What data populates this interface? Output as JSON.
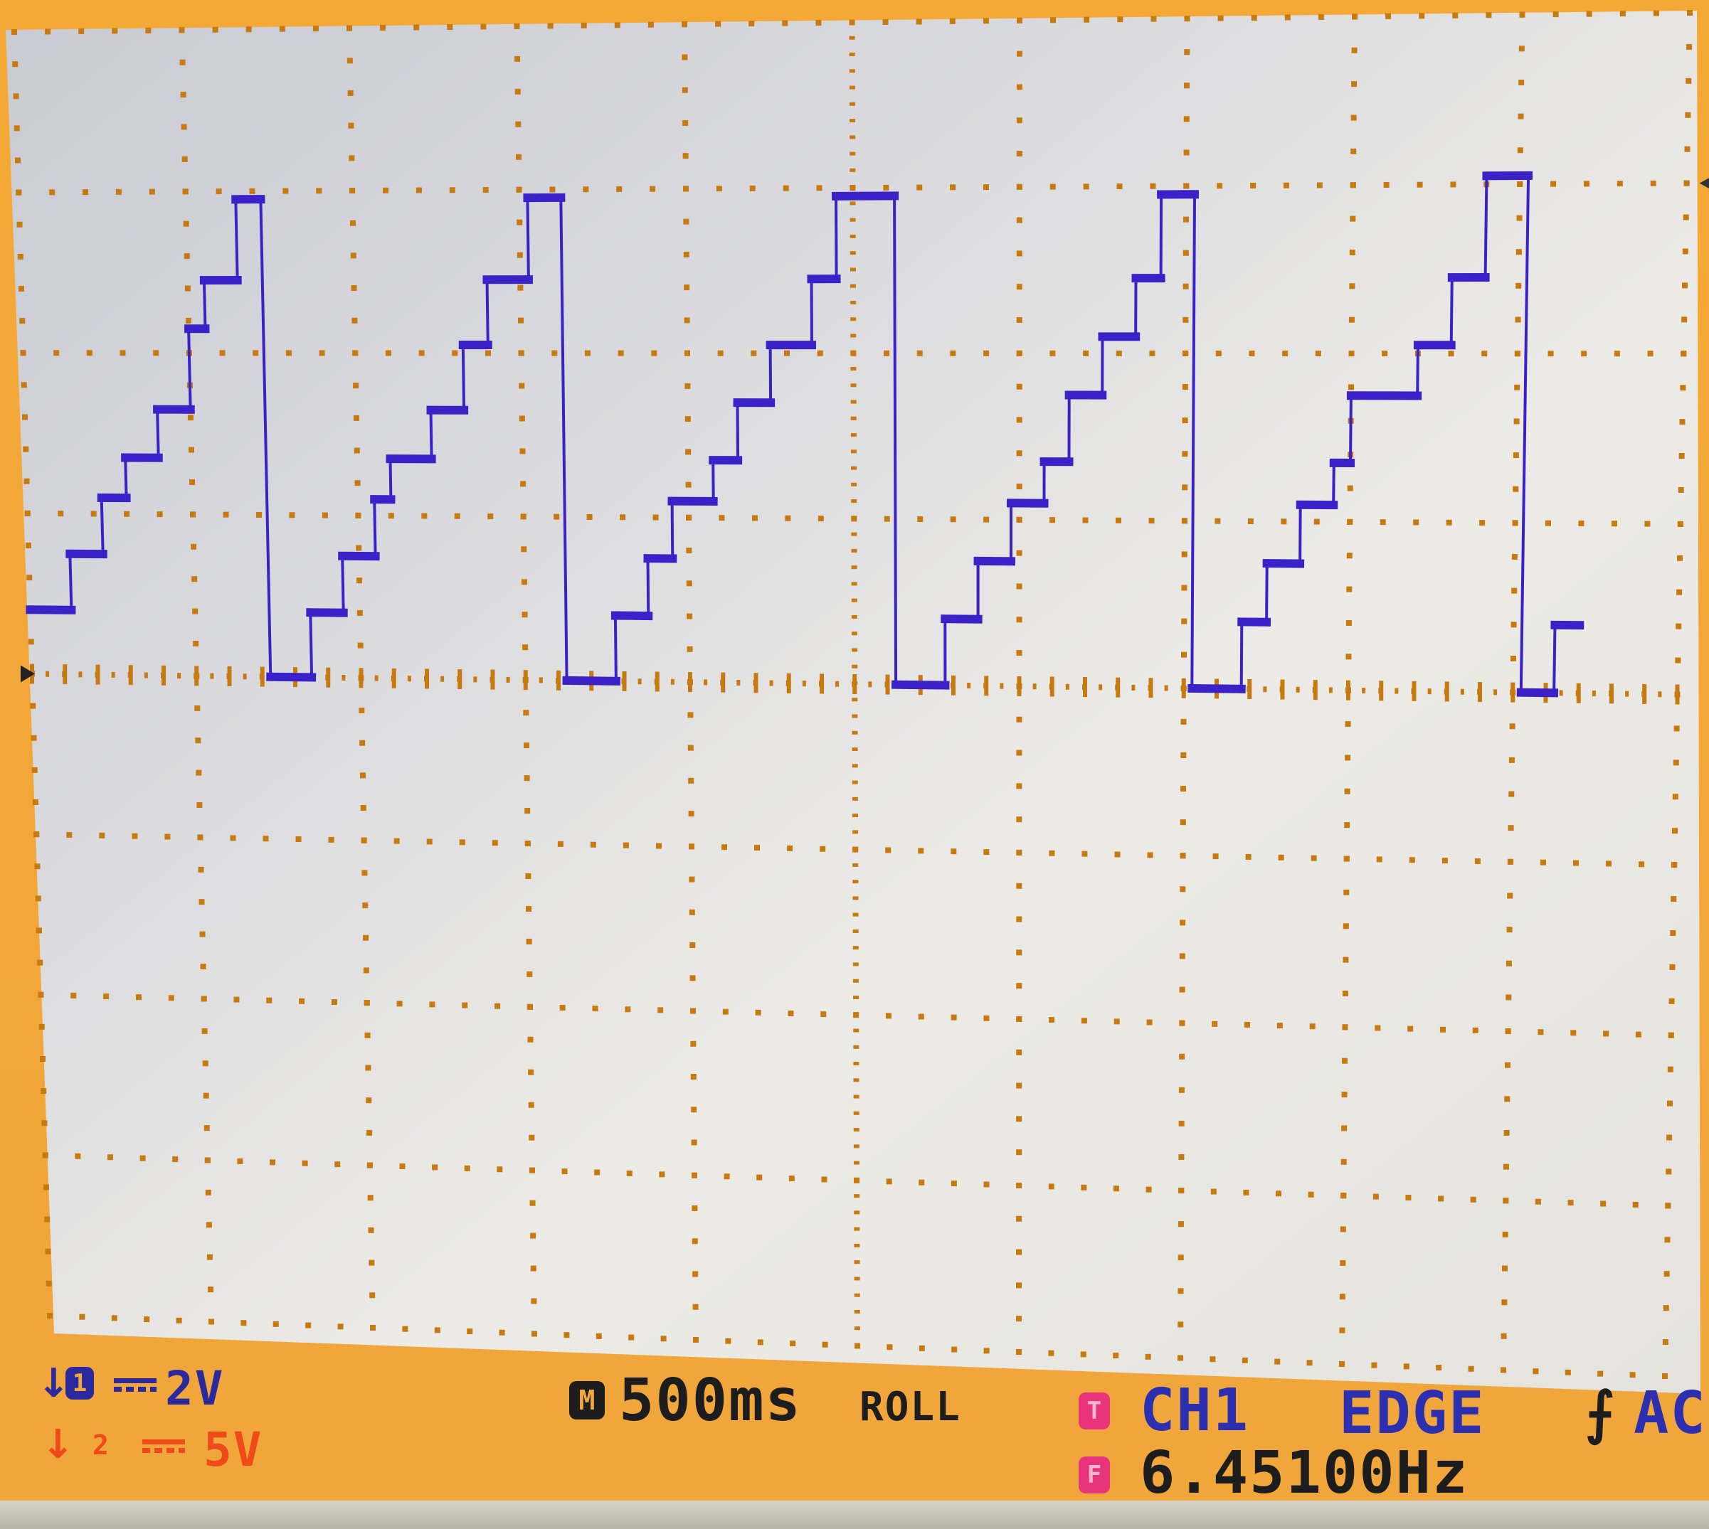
{
  "status": {
    "ch1_coupling": "2V",
    "ch2_coupling": "5V",
    "ch1_badge": "1",
    "ch2_badge": "2",
    "timebase_badge": "M",
    "timebase": "500ms",
    "mode": "ROLL",
    "trigger_badge": "T",
    "trigger_source": "CH1",
    "trigger_type": "EDGE",
    "trigger_coupling": "AC",
    "freq_badge": "F",
    "frequency": "6.45100Hz"
  },
  "colors": {
    "frame": "#f2a93a",
    "grid_dots": "#c77a10",
    "trace": "#3a22c8",
    "ch1_text": "#2a2a9e",
    "ch2_text": "#f04a1a",
    "trigger_text": "#2b2fb0",
    "badge_pink": "#e8347a",
    "dark_text": "#1d1d1d"
  },
  "chart_data": {
    "type": "line",
    "title": "",
    "xlabel": "",
    "ylabel": "",
    "grid": true,
    "legend": "none",
    "xlim": [
      0,
      10
    ],
    "ylim": [
      -4,
      4
    ],
    "series": [
      {
        "name": "CH1",
        "points": [
          [
            0.0,
            0.4
          ],
          [
            0.25,
            0.4
          ],
          [
            0.25,
            0.75
          ],
          [
            0.45,
            0.75
          ],
          [
            0.45,
            1.1
          ],
          [
            0.6,
            1.1
          ],
          [
            0.6,
            1.35
          ],
          [
            0.8,
            1.35
          ],
          [
            0.8,
            1.65
          ],
          [
            1.0,
            1.65
          ],
          [
            1.0,
            2.15
          ],
          [
            1.1,
            2.15
          ],
          [
            1.1,
            2.45
          ],
          [
            1.3,
            2.45
          ],
          [
            1.3,
            2.95
          ],
          [
            1.45,
            2.95
          ],
          [
            1.45,
            0.0
          ],
          [
            1.7,
            0.0
          ],
          [
            1.7,
            0.4
          ],
          [
            1.9,
            0.4
          ],
          [
            1.9,
            0.75
          ],
          [
            2.1,
            0.75
          ],
          [
            2.1,
            1.1
          ],
          [
            2.2,
            1.1
          ],
          [
            2.2,
            1.35
          ],
          [
            2.45,
            1.35
          ],
          [
            2.45,
            1.65
          ],
          [
            2.65,
            1.65
          ],
          [
            2.65,
            2.05
          ],
          [
            2.8,
            2.05
          ],
          [
            2.8,
            2.45
          ],
          [
            3.05,
            2.45
          ],
          [
            3.05,
            2.95
          ],
          [
            3.25,
            2.95
          ],
          [
            3.25,
            0.0
          ],
          [
            3.55,
            0.0
          ],
          [
            3.55,
            0.4
          ],
          [
            3.75,
            0.4
          ],
          [
            3.75,
            0.75
          ],
          [
            3.9,
            0.75
          ],
          [
            3.9,
            1.1
          ],
          [
            4.15,
            1.1
          ],
          [
            4.15,
            1.35
          ],
          [
            4.3,
            1.35
          ],
          [
            4.3,
            1.7
          ],
          [
            4.5,
            1.7
          ],
          [
            4.5,
            2.05
          ],
          [
            4.75,
            2.05
          ],
          [
            4.75,
            2.45
          ],
          [
            4.9,
            2.45
          ],
          [
            4.9,
            2.95
          ],
          [
            5.25,
            2.95
          ],
          [
            5.25,
            0.0
          ],
          [
            5.55,
            0.0
          ],
          [
            5.55,
            0.4
          ],
          [
            5.75,
            0.4
          ],
          [
            5.75,
            0.75
          ],
          [
            5.95,
            0.75
          ],
          [
            5.95,
            1.1
          ],
          [
            6.15,
            1.1
          ],
          [
            6.15,
            1.35
          ],
          [
            6.3,
            1.35
          ],
          [
            6.3,
            1.75
          ],
          [
            6.5,
            1.75
          ],
          [
            6.5,
            2.1
          ],
          [
            6.7,
            2.1
          ],
          [
            6.7,
            2.45
          ],
          [
            6.85,
            2.45
          ],
          [
            6.85,
            2.95
          ],
          [
            7.05,
            2.95
          ],
          [
            7.05,
            0.0
          ],
          [
            7.35,
            0.0
          ],
          [
            7.35,
            0.4
          ],
          [
            7.5,
            0.4
          ],
          [
            7.5,
            0.75
          ],
          [
            7.7,
            0.75
          ],
          [
            7.7,
            1.1
          ],
          [
            7.9,
            1.1
          ],
          [
            7.9,
            1.35
          ],
          [
            8.0,
            1.35
          ],
          [
            8.0,
            1.75
          ],
          [
            8.4,
            1.75
          ],
          [
            8.4,
            2.05
          ],
          [
            8.6,
            2.05
          ],
          [
            8.6,
            2.45
          ],
          [
            8.8,
            2.45
          ],
          [
            8.8,
            3.05
          ],
          [
            9.05,
            3.05
          ],
          [
            9.05,
            0.0
          ],
          [
            9.25,
            0.0
          ],
          [
            9.25,
            0.4
          ],
          [
            9.4,
            0.4
          ]
        ]
      }
    ],
    "trigger_level_marker": 0.0,
    "markers": [
      "T"
    ]
  }
}
